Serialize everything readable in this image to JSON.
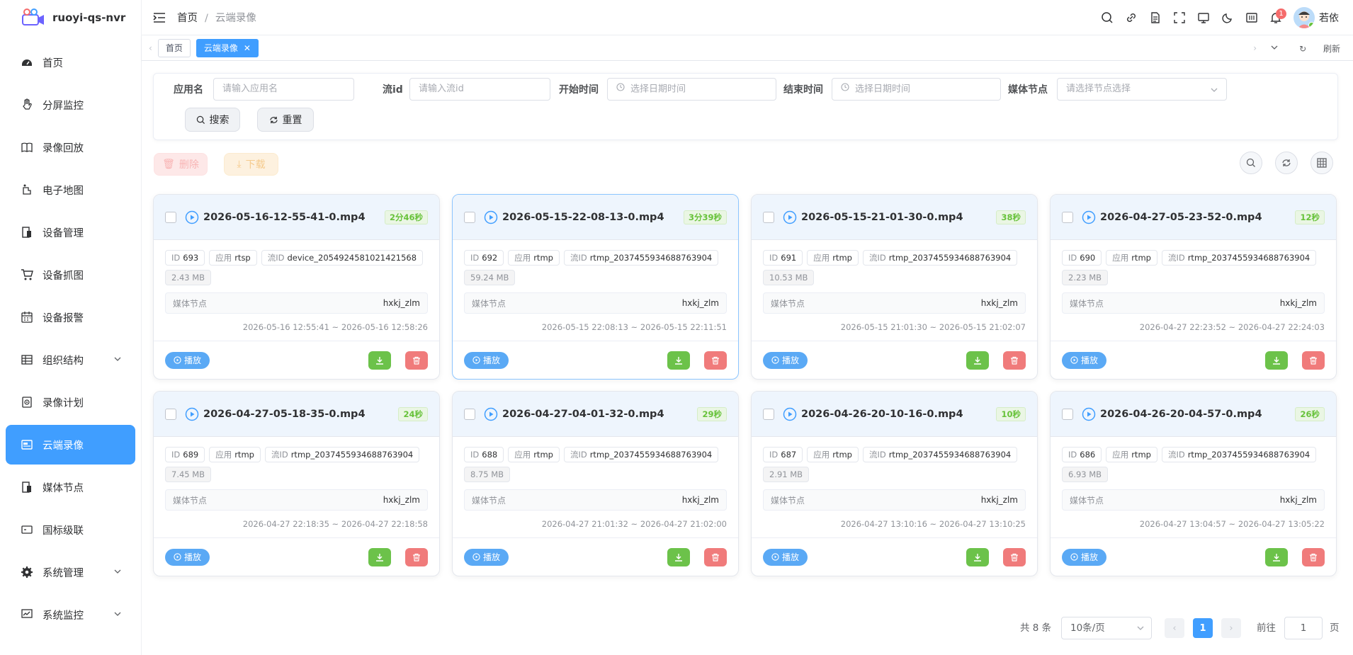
{
  "app": {
    "title": "ruoyi-qs-nvr"
  },
  "sidebar": {
    "items": [
      {
        "label": "首页",
        "icon": "dashboard-icon"
      },
      {
        "label": "分屏监控",
        "icon": "hand-icon"
      },
      {
        "label": "录像回放",
        "icon": "book-icon"
      },
      {
        "label": "电子地图",
        "icon": "map-icon"
      },
      {
        "label": "设备管理",
        "icon": "device-icon"
      },
      {
        "label": "设备抓图",
        "icon": "cart-icon"
      },
      {
        "label": "设备报警",
        "icon": "calendar-icon"
      },
      {
        "label": "组织结构",
        "icon": "table-icon",
        "expandable": true
      },
      {
        "label": "录像计划",
        "icon": "plan-icon"
      },
      {
        "label": "云端录像",
        "icon": "cloud-record-icon",
        "active": true
      },
      {
        "label": "媒体节点",
        "icon": "media-node-icon"
      },
      {
        "label": "国标级联",
        "icon": "cascade-icon"
      },
      {
        "label": "系统管理",
        "icon": "gear-icon",
        "expandable": true
      },
      {
        "label": "系统监控",
        "icon": "monitor-icon",
        "expandable": true
      }
    ]
  },
  "header": {
    "breadcrumb": [
      "首页",
      "云端录像"
    ],
    "separator": "/",
    "notification_count": "1",
    "username": "若依"
  },
  "tags": {
    "items": [
      "首页",
      "云端录像"
    ],
    "active": "云端录像",
    "refresh_label": "刷新"
  },
  "filters": {
    "app_name": {
      "label": "应用名",
      "placeholder": "请输入应用名"
    },
    "stream_id": {
      "label": "流id",
      "placeholder": "请输入流id"
    },
    "start_time": {
      "label": "开始时间",
      "placeholder": "选择日期时间"
    },
    "end_time": {
      "label": "结束时间",
      "placeholder": "选择日期时间"
    },
    "media_node": {
      "label": "媒体节点",
      "placeholder": "请选择节点选择"
    },
    "search_label": "搜索",
    "reset_label": "重置"
  },
  "actions": {
    "delete_label": "删除",
    "download_label": "下载"
  },
  "card_labels": {
    "id": "ID",
    "app": "应用",
    "stream": "流ID",
    "media_node": "媒体节点",
    "play": "播放"
  },
  "recordings": [
    {
      "file": "2026-05-16-12-55-41-0.mp4",
      "duration": "2分46秒",
      "id": "693",
      "app": "rtsp",
      "stream": "device_2054924581021421568",
      "size": "2.43 MB",
      "node": "hxkj_zlm",
      "time": "2026-05-16 12:55:41 ~ 2026-05-16 12:58:26"
    },
    {
      "file": "2026-05-15-22-08-13-0.mp4",
      "duration": "3分39秒",
      "id": "692",
      "app": "rtmp",
      "stream": "rtmp_2037455934688763904",
      "size": "59.24 MB",
      "node": "hxkj_zlm",
      "time": "2026-05-15 22:08:13 ~ 2026-05-15 22:11:51"
    },
    {
      "file": "2026-05-15-21-01-30-0.mp4",
      "duration": "38秒",
      "id": "691",
      "app": "rtmp",
      "stream": "rtmp_2037455934688763904",
      "size": "10.53 MB",
      "node": "hxkj_zlm",
      "time": "2026-05-15 21:01:30 ~ 2026-05-15 21:02:07"
    },
    {
      "file": "2026-04-27-05-23-52-0.mp4",
      "duration": "12秒",
      "id": "690",
      "app": "rtmp",
      "stream": "rtmp_2037455934688763904",
      "size": "2.23 MB",
      "node": "hxkj_zlm",
      "time": "2026-04-27 22:23:52 ~ 2026-04-27 22:24:03"
    },
    {
      "file": "2026-04-27-05-18-35-0.mp4",
      "duration": "24秒",
      "id": "689",
      "app": "rtmp",
      "stream": "rtmp_2037455934688763904",
      "size": "7.45 MB",
      "node": "hxkj_zlm",
      "time": "2026-04-27 22:18:35 ~ 2026-04-27 22:18:58"
    },
    {
      "file": "2026-04-27-04-01-32-0.mp4",
      "duration": "29秒",
      "id": "688",
      "app": "rtmp",
      "stream": "rtmp_2037455934688763904",
      "size": "8.75 MB",
      "node": "hxkj_zlm",
      "time": "2026-04-27 21:01:32 ~ 2026-04-27 21:02:00"
    },
    {
      "file": "2026-04-26-20-10-16-0.mp4",
      "duration": "10秒",
      "id": "687",
      "app": "rtmp",
      "stream": "rtmp_2037455934688763904",
      "size": "2.91 MB",
      "node": "hxkj_zlm",
      "time": "2026-04-27 13:10:16 ~ 2026-04-27 13:10:25"
    },
    {
      "file": "2026-04-26-20-04-57-0.mp4",
      "duration": "26秒",
      "id": "686",
      "app": "rtmp",
      "stream": "rtmp_2037455934688763904",
      "size": "6.93 MB",
      "node": "hxkj_zlm",
      "time": "2026-04-27 13:04:57 ~ 2026-04-27 13:05:22"
    }
  ],
  "pagination": {
    "total_label": "共 8 条",
    "page_size": "10条/页",
    "current_page": "1",
    "goto_label": "前往",
    "goto_value": "1",
    "page_suffix": "页"
  },
  "colors": {
    "primary": "#409eff",
    "success": "#67c23a",
    "danger": "#f56c6c"
  }
}
